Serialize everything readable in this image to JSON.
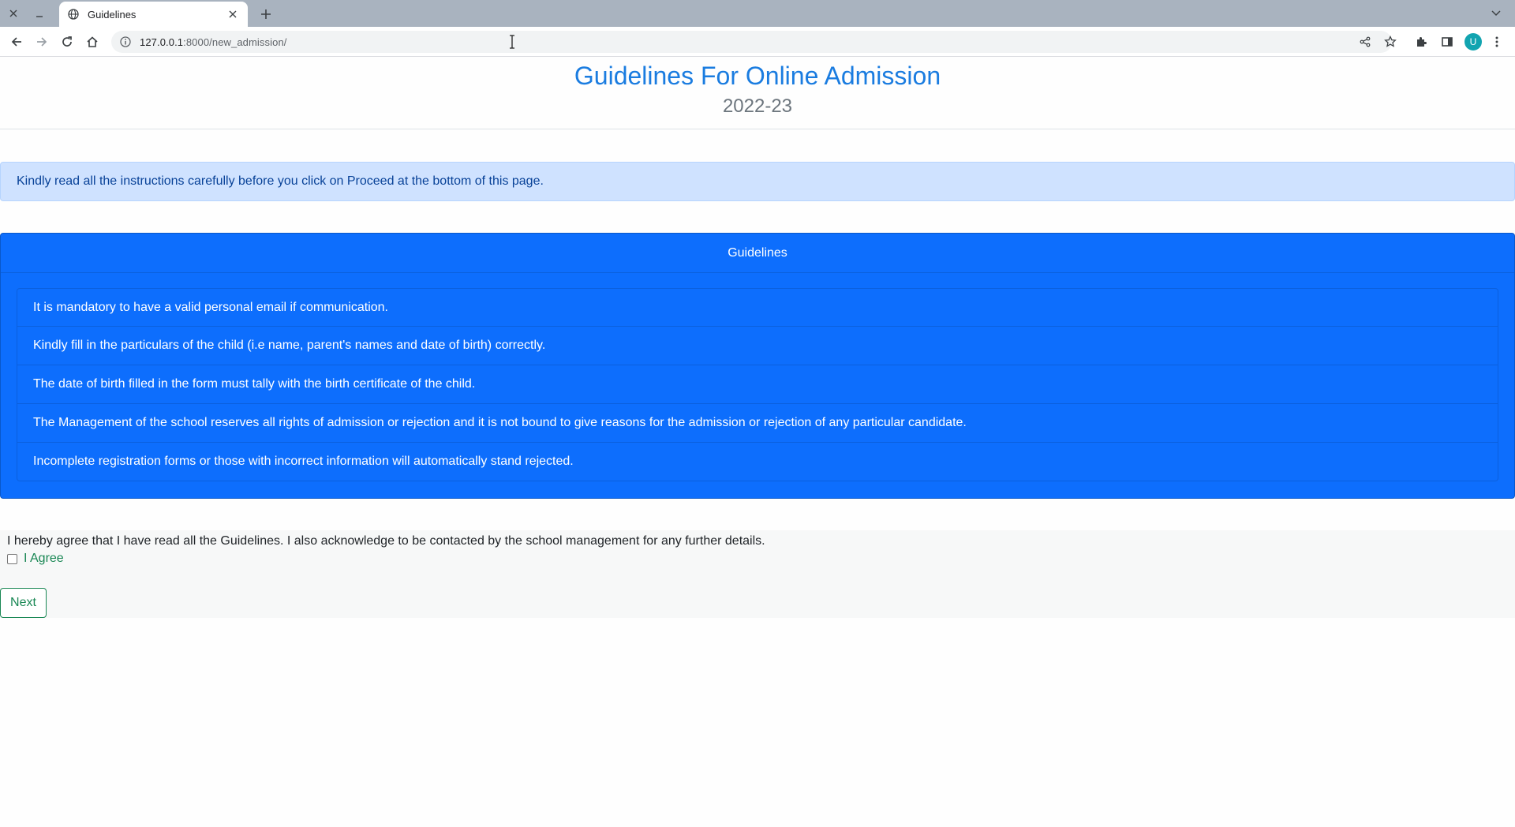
{
  "browser": {
    "tab_title": "Guidelines",
    "url_host": "127.0.0.1",
    "url_rest": ":8000/new_admission/",
    "avatar_letter": "U"
  },
  "header": {
    "title": "Guidelines For Online Admission",
    "year": "2022-23"
  },
  "alert": {
    "text": "Kindly read all the instructions carefully before you click on Proceed at the bottom of this page."
  },
  "guidelines": {
    "header": "Guidelines",
    "items": [
      "It is mandatory to have a valid personal email if communication.",
      "Kindly fill in the particulars of the child (i.e name, parent's names and date of birth) correctly.",
      "The date of birth filled in the form must tally with the birth certificate of the child.",
      "The Management of the school reserves all rights of admission or rejection and it is not bound to give reasons for the admission or rejection of any particular candidate.",
      "Incomplete registration forms or those with incorrect information will automatically stand rejected."
    ]
  },
  "agreement": {
    "text": "I hereby agree that I have read all the Guidelines. I also acknowledge to be contacted by the school management for any further details.",
    "checkbox_label": "I Agree",
    "checked": false,
    "next_label": "Next"
  },
  "colors": {
    "title": "#1a7ce0",
    "card": "#0d6efd",
    "alert_bg": "#cfe2ff",
    "success": "#198754"
  }
}
